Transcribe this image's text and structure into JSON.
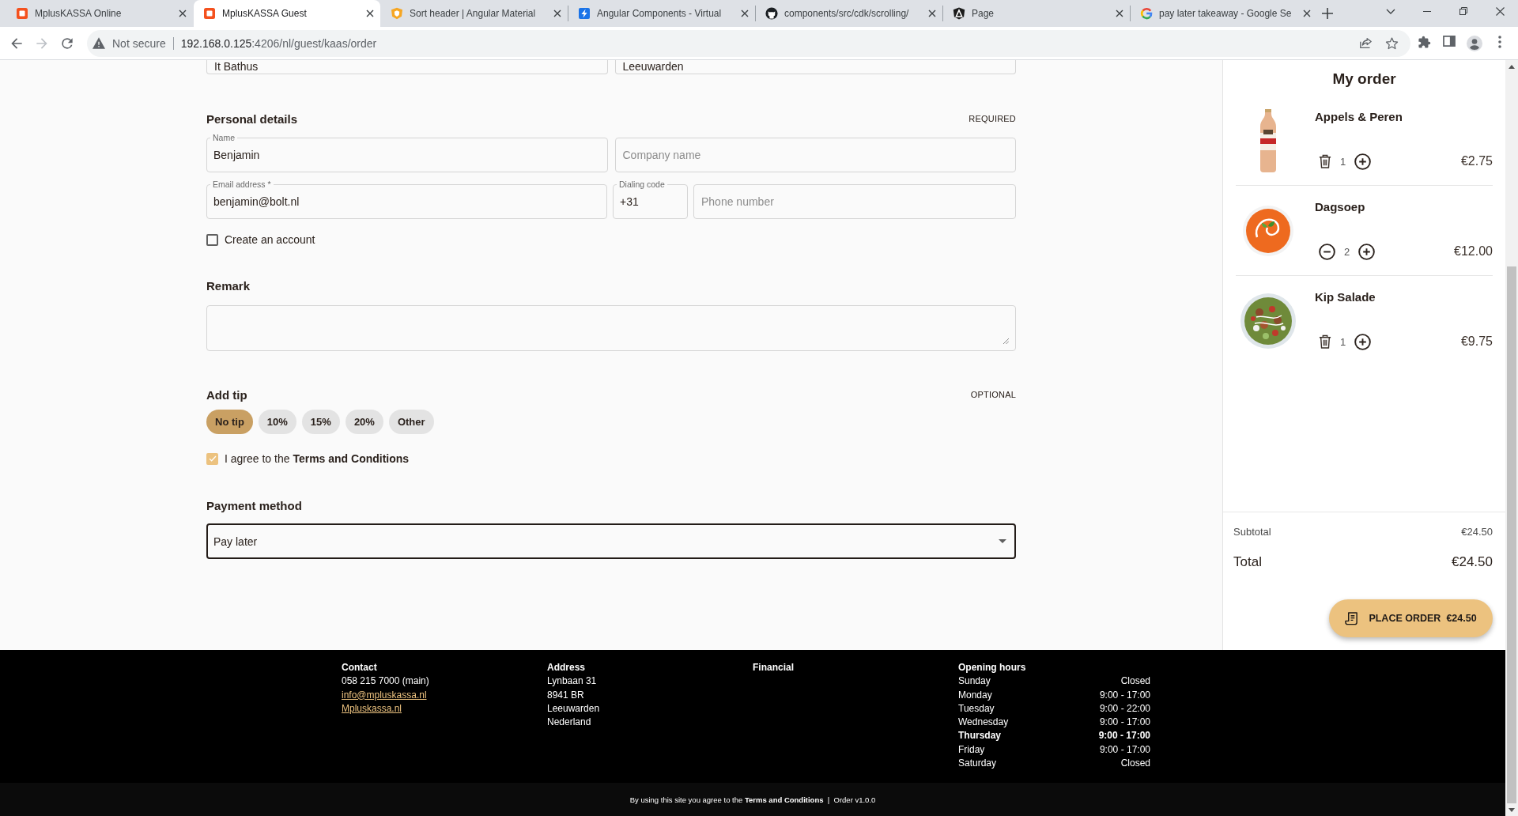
{
  "browser": {
    "tabs": [
      {
        "title": "MplusKASSA Online",
        "kind": "tile",
        "selected": false
      },
      {
        "title": "MplusKASSA Guest",
        "kind": "tile",
        "selected": true
      },
      {
        "title": "Sort header | Angular Material",
        "kind": "shield",
        "selected": false
      },
      {
        "title": "Angular Components - Virtual",
        "kind": "bolt",
        "selected": false
      },
      {
        "title": "components/src/cdk/scrolling/",
        "kind": "cat",
        "selected": false
      },
      {
        "title": "Page",
        "kind": "hexagon",
        "selected": false
      },
      {
        "title": "pay later takeaway - Google Se",
        "kind": "g",
        "selected": false
      }
    ],
    "nav_buttons": [
      {
        "kind": "back",
        "disabled": false
      },
      {
        "kind": "forward",
        "disabled": true
      },
      {
        "kind": "reload",
        "disabled": false
      }
    ],
    "security": "Not secure",
    "url": {
      "host": "192.168.0.125",
      "path": ":4206/nl/guest/kaas/order"
    }
  },
  "checkout": {
    "address_fields": [
      {
        "value": "It Bathus"
      },
      {
        "value": "Leeuwarden"
      }
    ],
    "personal": {
      "title": "Personal details",
      "badge": "REQUIRED",
      "rows": [
        [
          {
            "label": "Name",
            "value": "Benjamin"
          },
          {
            "placeholder": "Company name"
          }
        ],
        [
          {
            "label": "Email address *",
            "value": "benjamin@bolt.nl"
          },
          {
            "label": "Dialing code",
            "value": "+31"
          },
          {
            "placeholder": "Phone number"
          }
        ]
      ],
      "create_account": {
        "label": "Create an account",
        "checked": false
      }
    },
    "remark": {
      "title": "Remark"
    },
    "tip": {
      "title": "Add tip",
      "badge": "OPTIONAL",
      "options": [
        {
          "label": "No tip",
          "selected": true
        },
        {
          "label": "10%",
          "selected": false
        },
        {
          "label": "15%",
          "selected": false
        },
        {
          "label": "20%",
          "selected": false
        },
        {
          "label": "Other",
          "selected": false
        }
      ]
    },
    "terms": {
      "text": "I agree to the **Terms and Conditions**",
      "checked": true
    },
    "payment": {
      "title": "Payment method",
      "value": "Pay later"
    }
  },
  "order": {
    "title": "My order",
    "items": [
      {
        "name": "Appels & Peren",
        "kind": "drink",
        "removable": true,
        "quantity": "1",
        "price": "€2.75"
      },
      {
        "name": "Dagsoep",
        "kind": "soup",
        "removable": false,
        "quantity": "2",
        "price": "€12.00"
      },
      {
        "name": "Kip Salade",
        "kind": "salad",
        "removable": true,
        "quantity": "1",
        "price": "€9.75"
      }
    ],
    "subtotal_label": "Subtotal",
    "subtotal": "€24.50",
    "total_label": "Total",
    "total": "€24.50",
    "place_order": {
      "label": "PLACE ORDER",
      "amount": "€24.50"
    }
  },
  "footer": {
    "columns": [
      {
        "title": "Contact",
        "lines": [
          {
            "text": "058 215 7000 (main)",
            "kind": "text"
          },
          {
            "text": "info@mpluskassa.nl",
            "kind": "link"
          },
          {
            "text": "Mpluskassa.nl",
            "kind": "link"
          }
        ]
      },
      {
        "title": "Address",
        "lines": [
          {
            "text": "Lynbaan 31",
            "kind": "text"
          },
          {
            "text": "8941 BR",
            "kind": "text"
          },
          {
            "text": "Leeuwarden",
            "kind": "text"
          },
          {
            "text": "Nederland",
            "kind": "text"
          }
        ]
      },
      {
        "title": "Financial"
      }
    ],
    "opening_hours": {
      "title": "Opening hours",
      "days": [
        {
          "day": "Sunday",
          "hours": "Closed",
          "current": false
        },
        {
          "day": "Monday",
          "hours": "9:00 - 17:00",
          "current": false
        },
        {
          "day": "Tuesday",
          "hours": "9:00 - 22:00",
          "current": false
        },
        {
          "day": "Wednesday",
          "hours": "9:00 - 17:00",
          "current": false
        },
        {
          "day": "Thursday",
          "hours": "9:00 - 17:00",
          "current": true
        },
        {
          "day": "Friday",
          "hours": "9:00 - 17:00",
          "current": false
        },
        {
          "day": "Saturday",
          "hours": "Closed",
          "current": false
        }
      ]
    },
    "notice": "By using this site you agree to the **Terms and Conditions**  |  Order v1.0.0"
  }
}
